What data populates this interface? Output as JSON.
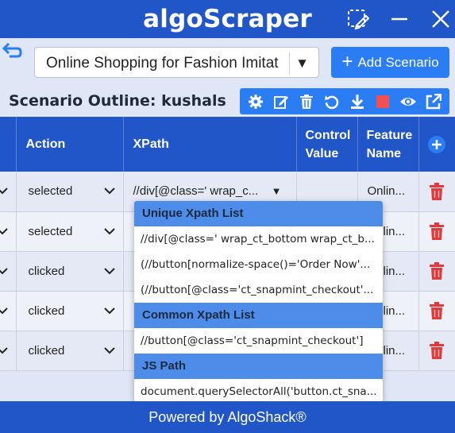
{
  "app": {
    "title": "algoScraper"
  },
  "scenario": {
    "selected": "Online Shopping for Fashion Imitat",
    "add_label": "Add Scenario"
  },
  "outline": {
    "title": "Scenario Outline: kushals"
  },
  "table": {
    "columns": [
      "Action",
      "XPath",
      "Control Value",
      "Feature Name"
    ],
    "columns_lines": {
      "control": [
        "Control",
        "Value"
      ],
      "feature": [
        "Feature",
        "Name"
      ]
    },
    "rows": [
      {
        "action": "selected",
        "xpath": "//div[@class=' wrap_c...",
        "control": "",
        "feature": "Onlin..."
      },
      {
        "action": "selected",
        "xpath": "",
        "control": "",
        "feature": "Onlin..."
      },
      {
        "action": "clicked",
        "xpath": "",
        "control": "",
        "feature": "Onlin..."
      },
      {
        "action": "clicked",
        "xpath": "",
        "control": "",
        "feature": "Onlin..."
      },
      {
        "action": "clicked",
        "xpath": "",
        "control": "",
        "feature": "Onlin..."
      }
    ]
  },
  "dropdown": {
    "unique_header": "Unique Xpath List",
    "unique_items": [
      "//div[@class=' wrap_ct_bottom wrap_ct_b...",
      "(//button[normalize-space()='Order Now'...",
      "(//button[@class='ct_snapmint_checkout'..."
    ],
    "common_header": "Common Xpath List",
    "common_items": [
      "//button[@class='ct_snapmint_checkout']"
    ],
    "js_header": "JS Path",
    "js_items": [
      "document.querySelectorAll('button.ct_sna..."
    ]
  },
  "footer": {
    "text": "Powered by AlgoShack®"
  },
  "colors": {
    "primary": "#2156c9",
    "accent": "#2a7df5",
    "delete": "#e03a3a",
    "background": "#dfe6f5"
  },
  "icons": {
    "toolbar": [
      "settings-icon",
      "edit-icon",
      "delete-icon",
      "refresh-icon",
      "download-icon",
      "stop-icon",
      "view-icon",
      "external-link-icon"
    ],
    "titlebar": [
      "pin-icon",
      "minimize-icon",
      "close-icon"
    ]
  }
}
